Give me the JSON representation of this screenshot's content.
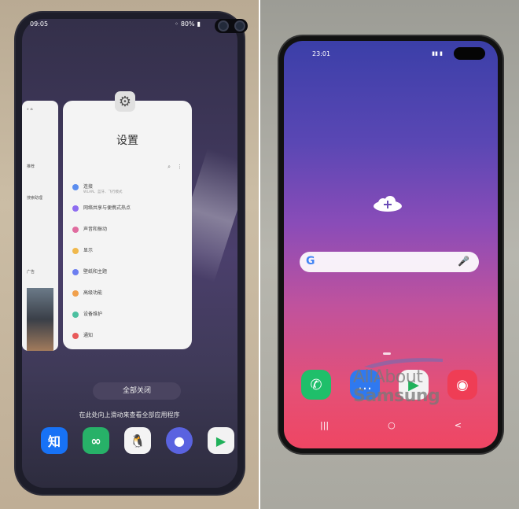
{
  "left": {
    "status": {
      "time": "09:05",
      "battery": "80%"
    },
    "back_card_texts": [
      "搜索助理",
      "推荐",
      "广告"
    ],
    "card": {
      "app_name": "设置",
      "rows": [
        {
          "title": "连接",
          "sub": "WLAN、蓝牙、飞行模式",
          "color": "#5b8def"
        },
        {
          "title": "网络共享与便携式热点",
          "sub": "",
          "color": "#8e6cf0"
        },
        {
          "title": "声音和振动",
          "sub": "",
          "color": "#e06c9f"
        },
        {
          "title": "显示",
          "sub": "",
          "color": "#f0b84c"
        },
        {
          "title": "壁纸和主题",
          "sub": "",
          "color": "#6c7ef0"
        },
        {
          "title": "高级功能",
          "sub": "",
          "color": "#f0a04c"
        },
        {
          "title": "设备维护",
          "sub": "",
          "color": "#4cc0a0"
        },
        {
          "title": "通知",
          "sub": "",
          "color": "#e85a5a"
        }
      ]
    },
    "close_all": "全部关闭",
    "hint": "在此处向上滑动来查看全部应用程序",
    "dock": [
      {
        "name": "zhihu",
        "label": "知",
        "color": "#1772f6"
      },
      {
        "name": "link",
        "label": "∞",
        "color": "#27b168"
      },
      {
        "name": "qq",
        "label": "🐧",
        "color": "#f4f4f4"
      },
      {
        "name": "bixby",
        "label": "●",
        "color": "#5a63e0"
      },
      {
        "name": "play-store",
        "label": "▶",
        "color": "#f2f2f2"
      }
    ]
  },
  "right": {
    "status": {
      "time": "23:01"
    },
    "search": {
      "g": "G",
      "mic": "🎤"
    },
    "dock": [
      {
        "name": "phone",
        "label": "✆",
        "color": "#1fbf6a"
      },
      {
        "name": "messages",
        "label": "…",
        "color": "#2f79f0"
      },
      {
        "name": "play-store",
        "label": "▶",
        "color": "#f3f3f3"
      },
      {
        "name": "camera",
        "label": "◉",
        "color": "#ef3d55"
      }
    ],
    "nav": [
      "|||",
      "○",
      "<"
    ],
    "watermark": {
      "line1": "AllAbout",
      "line2": "Samsung"
    }
  }
}
